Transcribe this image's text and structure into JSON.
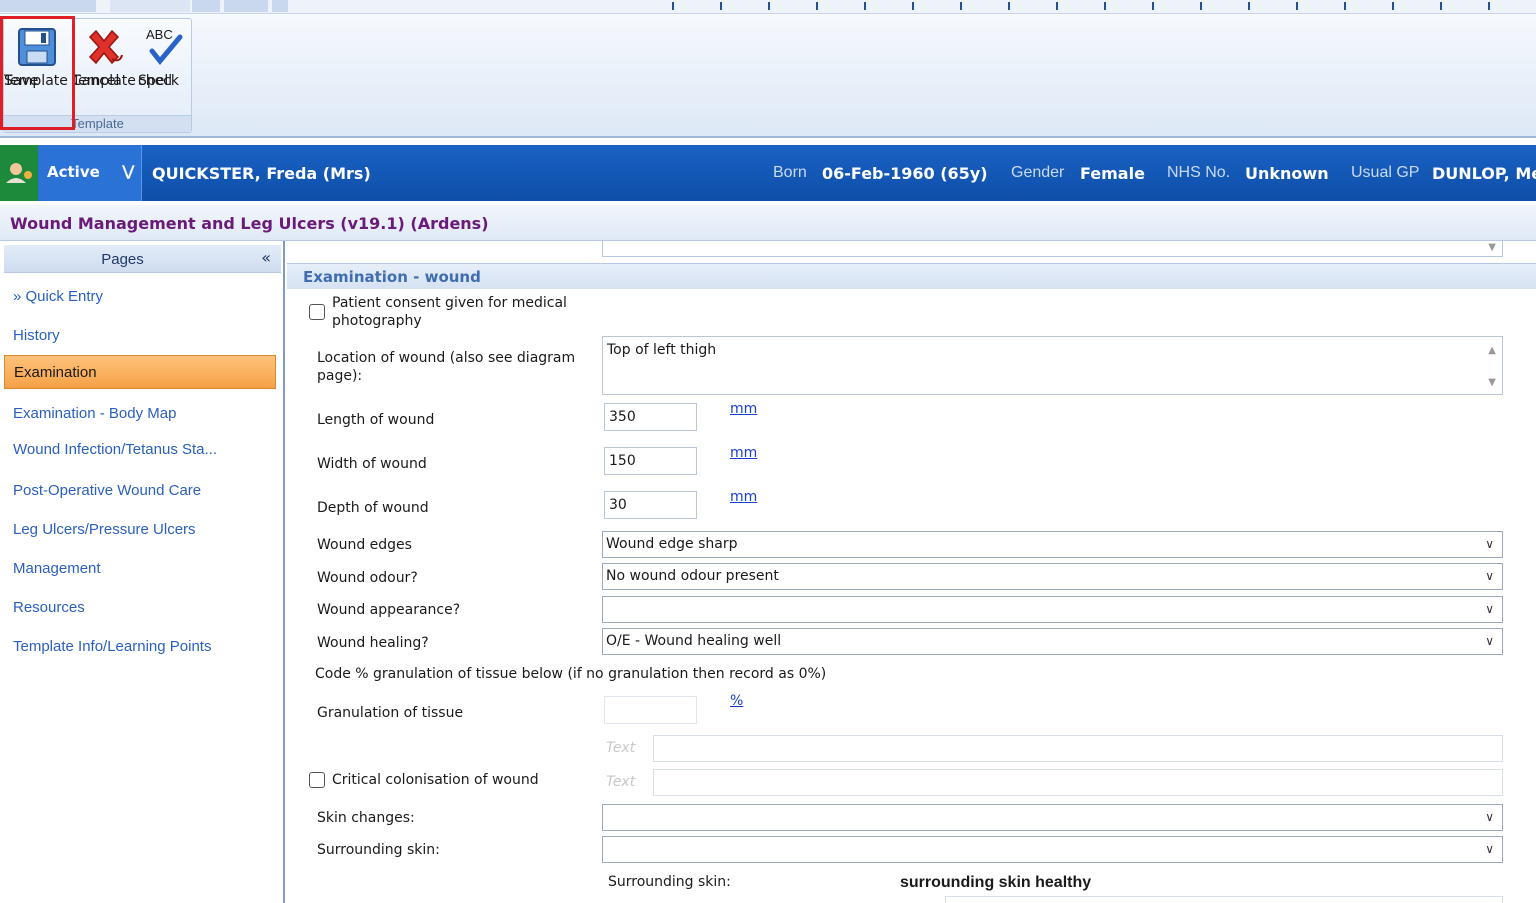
{
  "ribbon": {
    "buttons": [
      {
        "label_line1": "Save",
        "label_line2": "Template",
        "icon": "floppy-disk-icon"
      },
      {
        "label_line1": "Cancel",
        "label_line2": "Template",
        "icon": "red-x-icon"
      },
      {
        "label_line1": "Spell",
        "label_line2": "check",
        "icon_text": "ABC",
        "icon": "check-mark-icon"
      }
    ],
    "group_label": "Template"
  },
  "banner": {
    "status": "Active",
    "patient_name": "QUICKSTER, Freda (Mrs)",
    "born_label": "Born",
    "born_value": "06-Feb-1960 (65y)",
    "gender_label": "Gender",
    "gender_value": "Female",
    "nhs_label": "NHS No.",
    "nhs_value": "Unknown",
    "gp_label": "Usual GP",
    "gp_value": "DUNLOP, Me"
  },
  "template_title": "Wound Management and Leg Ulcers (v19.1) (Ardens)",
  "nav": {
    "header": "Pages",
    "collapse_glyph": "«",
    "items": [
      {
        "label": "» Quick Entry"
      },
      {
        "label": "History"
      },
      {
        "label": "Examination"
      },
      {
        "label": "Examination - Body Map"
      },
      {
        "label": "Wound Infection/Tetanus Sta..."
      },
      {
        "label": "Post-Operative Wound Care"
      },
      {
        "label": "Leg Ulcers/Pressure Ulcers"
      },
      {
        "label": "Management"
      },
      {
        "label": "Resources"
      },
      {
        "label": "Template Info/Learning Points"
      }
    ],
    "active_index": 2
  },
  "form": {
    "section_title": "Examination - wound",
    "consent_label": "Patient consent given for medical photography",
    "consent_checked": false,
    "location_label": "Location of wound (also see diagram page):",
    "location_value": "Top of left thigh",
    "length_label": "Length of wound",
    "length_value": "350",
    "width_label": "Width of wound",
    "width_value": "150",
    "depth_label": "Depth of wound",
    "depth_value": "30",
    "unit_mm": "mm",
    "edges_label": "Wound edges",
    "edges_value": "Wound edge sharp",
    "odour_label": "Wound odour?",
    "odour_value": "No wound odour present",
    "appearance_label": "Wound appearance?",
    "appearance_value": "",
    "healing_label": "Wound healing?",
    "healing_value": "O/E - Wound healing well",
    "granulation_note": "Code % granulation of tissue below (if no granulation then record as 0%)",
    "granulation_label": "Granulation of tissue",
    "granulation_value": "",
    "unit_percent": "%",
    "text_placeholder": "Text",
    "colonisation_label": "Critical colonisation of wound",
    "colonisation_checked": false,
    "skin_changes_label": "Skin changes:",
    "skin_changes_value": "",
    "surrounding_label": "Surrounding skin:",
    "surrounding_value": "",
    "surrounding_label_2": "Surrounding skin:",
    "surrounding_value_2": "surrounding skin healthy"
  },
  "colors": {
    "banner_blue": "#1b62c4",
    "active_orange": "#f5a147",
    "title_purple": "#6a1a7a",
    "nav_link_blue": "#2a5fc0",
    "highlight_red": "#e01e26"
  }
}
